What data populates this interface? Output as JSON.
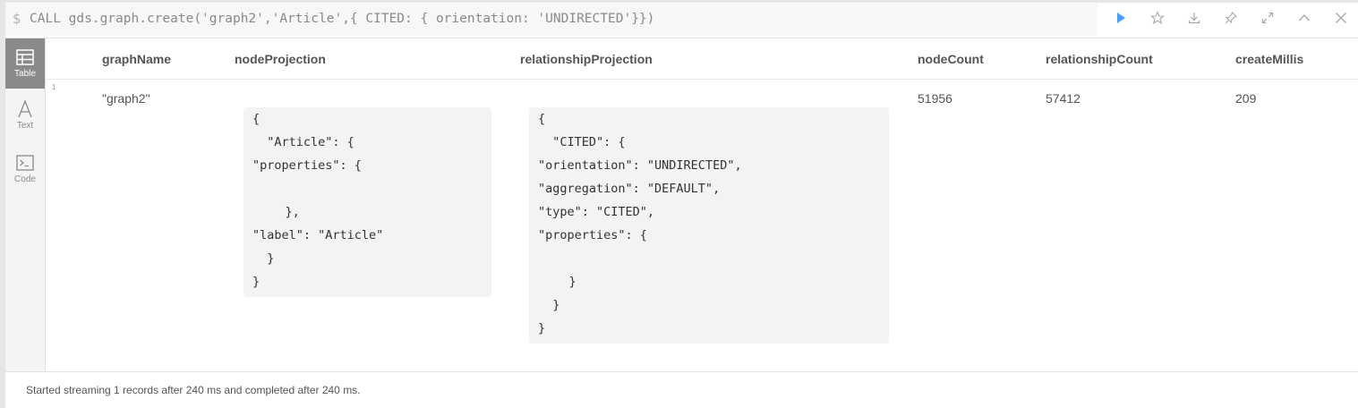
{
  "editor": {
    "prompt": "$",
    "query": "CALL gds.graph.create('graph2','Article',{ CITED: { orientation: 'UNDIRECTED'}})"
  },
  "toolbar": {
    "icons": [
      "run-icon",
      "star-icon",
      "download-icon",
      "pin-icon",
      "expand-icon",
      "collapse-icon",
      "close-icon"
    ],
    "accent": "#4a9df8"
  },
  "sidebar": {
    "items": [
      {
        "label": "Table",
        "icon": "table-icon"
      },
      {
        "label": "Text",
        "icon": "text-icon"
      },
      {
        "label": "Code",
        "icon": "code-icon"
      }
    ]
  },
  "table": {
    "headers": [
      "graphName",
      "nodeProjection",
      "relationshipProjection",
      "nodeCount",
      "relationshipCount",
      "createMillis"
    ],
    "row_number": "1",
    "row": {
      "graphName": "\"graph2\"",
      "nodeCount": "51956",
      "relationshipCount": "57412",
      "createMillis": "209"
    },
    "nodeProjection_lines": [
      "{",
      "  \"Article\": {",
      "\"properties\": {",
      "",
      "    },",
      "\"label\": \"Article\"",
      "  }",
      "}"
    ],
    "relationshipProjection_lines": [
      "{",
      "  \"CITED\": {",
      "\"orientation\": \"UNDIRECTED\",",
      "\"aggregation\": \"DEFAULT\",",
      "\"type\": \"CITED\",",
      "\"properties\": {",
      "",
      "    }",
      "  }",
      "}"
    ]
  },
  "status": "Started streaming 1 records after 240 ms and completed after 240 ms."
}
